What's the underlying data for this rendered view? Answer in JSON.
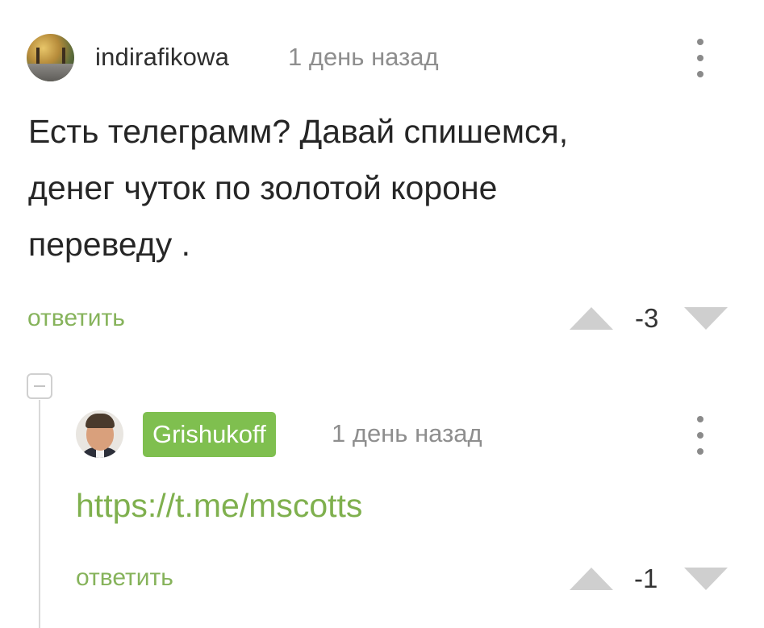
{
  "comments": [
    {
      "username": "indirafikowa",
      "time": "1 день назад",
      "body_lines": [
        "Есть телеграмм? Давай спишемся,",
        "денег чуток по золотой короне",
        "переведу ."
      ],
      "reply_label": "ответить",
      "score": "-3",
      "avatar_icon": "avatar-photo-autumn-road"
    },
    {
      "username": "Grishukoff",
      "time": "1 день назад",
      "link": "https://t.me/mscotts",
      "reply_label": "ответить",
      "score": "-1",
      "avatar_icon": "avatar-photo-man-in-suit",
      "badge_color": "#7fbf4f"
    }
  ],
  "colors": {
    "accent_green": "#86b35b",
    "link_green": "#7fb04e",
    "muted_gray": "#8e8e8e",
    "vote_arrow": "#cfcfcf"
  }
}
